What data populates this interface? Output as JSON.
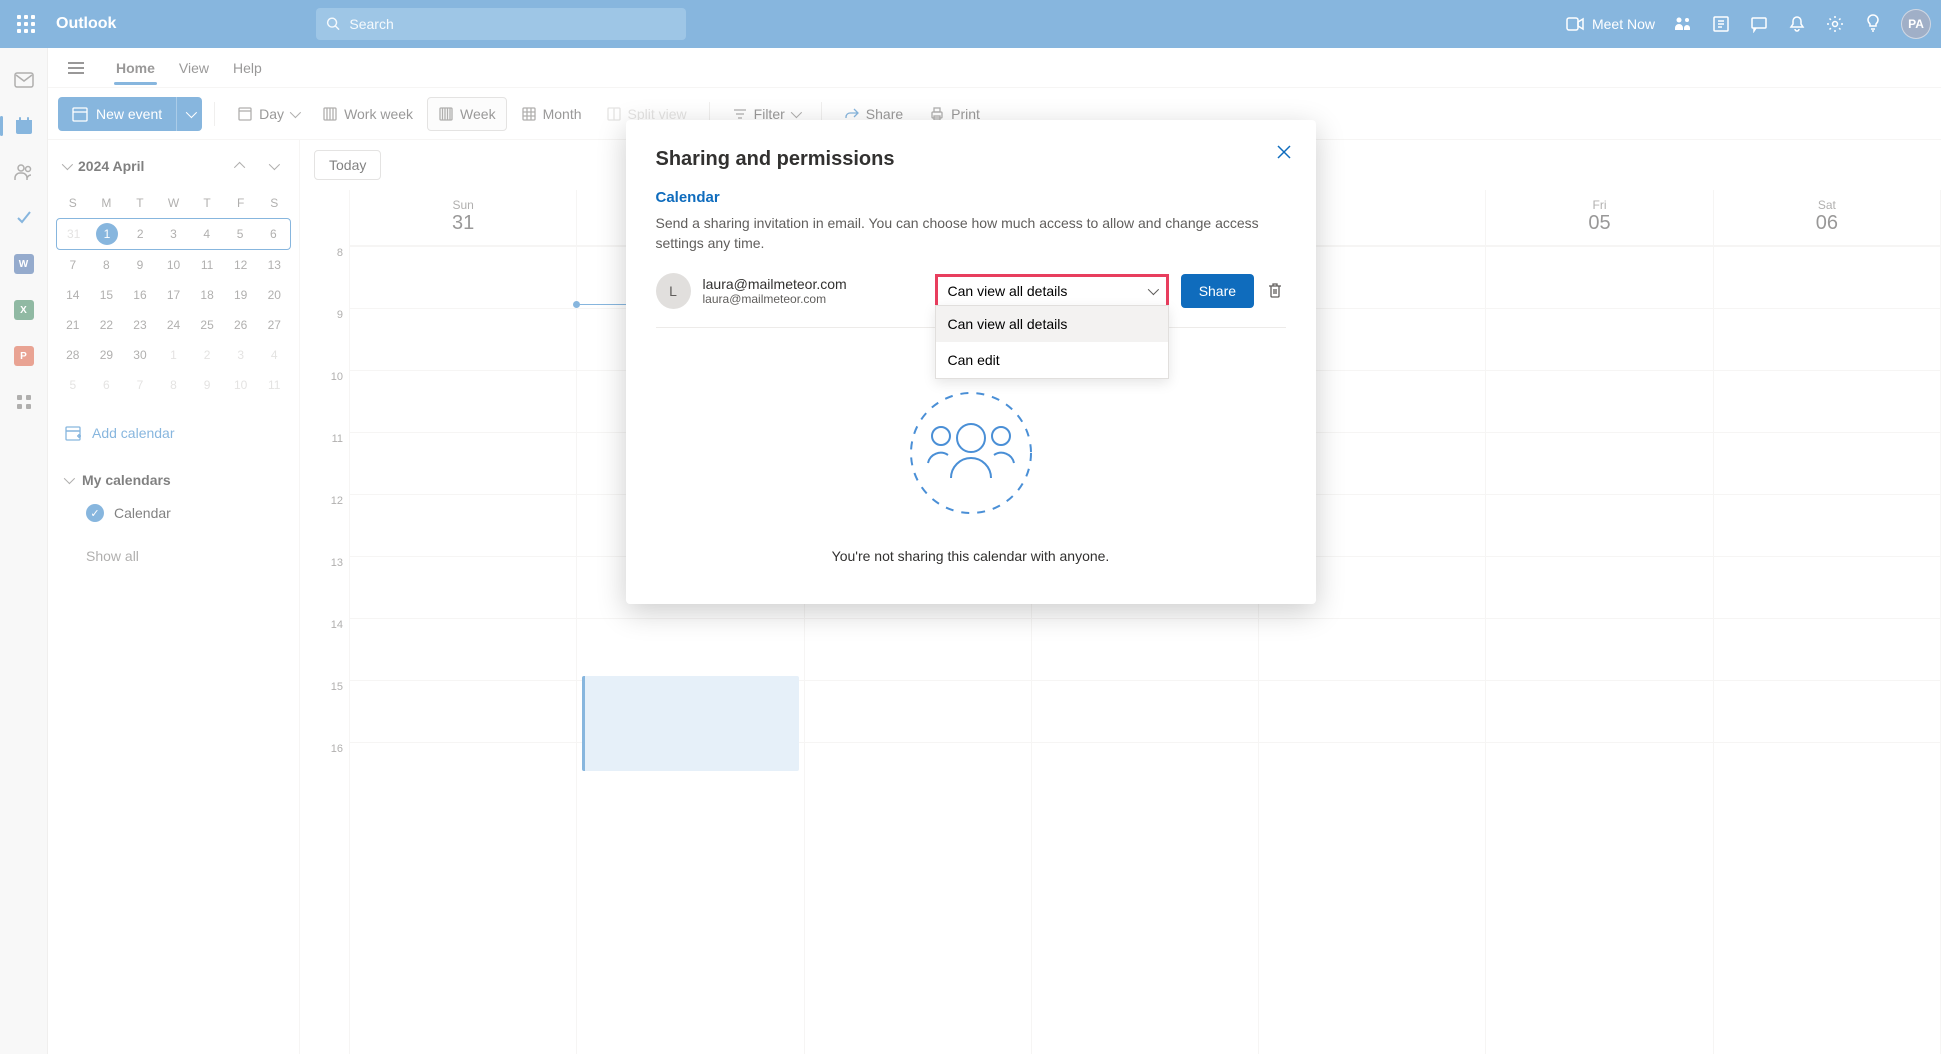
{
  "header": {
    "app_name": "Outlook",
    "search_placeholder": "Search",
    "meet_now": "Meet Now",
    "avatar_initials": "PA"
  },
  "tabs": {
    "home": "Home",
    "view": "View",
    "help": "Help"
  },
  "toolbar": {
    "new_event": "New event",
    "day": "Day",
    "work_week": "Work week",
    "week": "Week",
    "month": "Month",
    "split_view": "Split view",
    "filter": "Filter",
    "share": "Share",
    "print": "Print"
  },
  "sidebar": {
    "month_label": "2024 April",
    "day_headers": [
      "S",
      "M",
      "T",
      "W",
      "T",
      "F",
      "S"
    ],
    "weeks": [
      [
        "31",
        "1",
        "2",
        "3",
        "4",
        "5",
        "6"
      ],
      [
        "7",
        "8",
        "9",
        "10",
        "11",
        "12",
        "13"
      ],
      [
        "14",
        "15",
        "16",
        "17",
        "18",
        "19",
        "20"
      ],
      [
        "21",
        "22",
        "23",
        "24",
        "25",
        "26",
        "27"
      ],
      [
        "28",
        "29",
        "30",
        "1",
        "2",
        "3",
        "4"
      ],
      [
        "5",
        "6",
        "7",
        "8",
        "9",
        "10",
        "11"
      ]
    ],
    "add_calendar": "Add calendar",
    "my_calendars": "My calendars",
    "calendar_item": "Calendar",
    "show_all": "Show all",
    "today_btn": "Today"
  },
  "calendar": {
    "day_headers": [
      {
        "name": "Sun",
        "num": "31"
      },
      {
        "name": "",
        "num": ""
      },
      {
        "name": "",
        "num": ""
      },
      {
        "name": "",
        "num": ""
      },
      {
        "name": "",
        "num": ""
      },
      {
        "name": "Fri",
        "num": "05"
      },
      {
        "name": "Sat",
        "num": "06"
      }
    ],
    "time_labels": [
      "8",
      "9",
      "10",
      "11",
      "12",
      "13",
      "14",
      "15",
      "16"
    ]
  },
  "dialog": {
    "title": "Sharing and permissions",
    "subtitle": "Calendar",
    "description": "Send a sharing invitation in email. You can choose how much access to allow and change access settings any time.",
    "user_avatar": "L",
    "user_name": "laura@mailmeteor.com",
    "user_email": "laura@mailmeteor.com",
    "selected_permission": "Can view all details",
    "options": {
      "view": "Can view all details",
      "edit": "Can edit"
    },
    "share_btn": "Share",
    "empty_text": "You're not sharing this calendar with anyone."
  }
}
